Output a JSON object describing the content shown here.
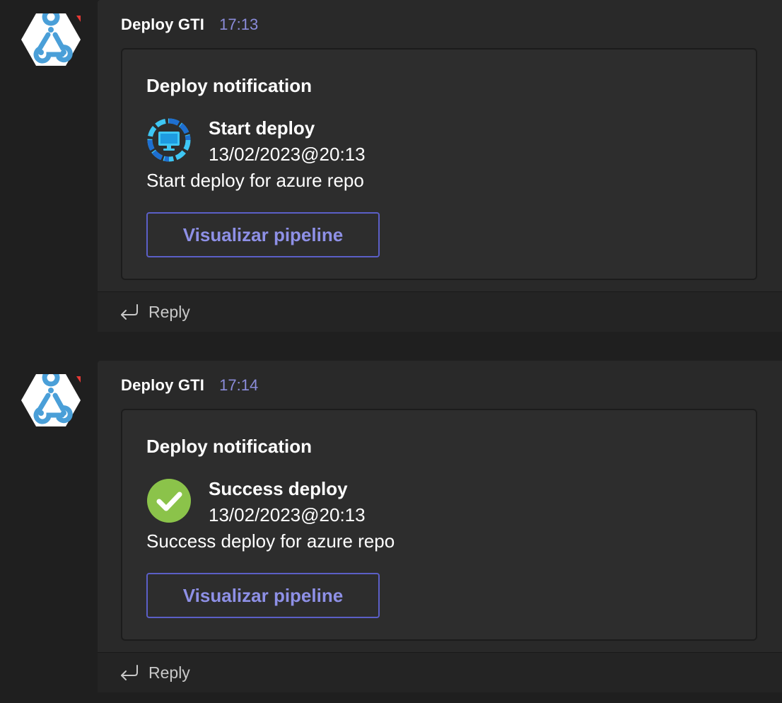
{
  "messages": [
    {
      "sender": "Deploy GTI",
      "time": "17:13",
      "avatar_icon": "webhook-icon",
      "card": {
        "title": "Deploy notification",
        "status_icon": "monitor-deploy-icon",
        "status_title": "Start deploy",
        "status_date": "13/02/2023@20:13",
        "description": "Start deploy for azure repo",
        "action_label": "Visualizar pipeline"
      },
      "reply_label": "Reply"
    },
    {
      "sender": "Deploy GTI",
      "time": "17:14",
      "avatar_icon": "webhook-icon",
      "card": {
        "title": "Deploy notification",
        "status_icon": "success-check-icon",
        "status_title": "Success deploy",
        "status_date": "13/02/2023@20:13",
        "description": "Success deploy for azure repo",
        "action_label": "Visualizar pipeline"
      },
      "reply_label": "Reply"
    }
  ],
  "colors": {
    "accent": "#8b8cdb",
    "button_border": "#5b5fc7",
    "success": "#8bc34a",
    "monitor": "#3ec7f4",
    "background": "#1f1f1f",
    "thread": "#292929"
  }
}
